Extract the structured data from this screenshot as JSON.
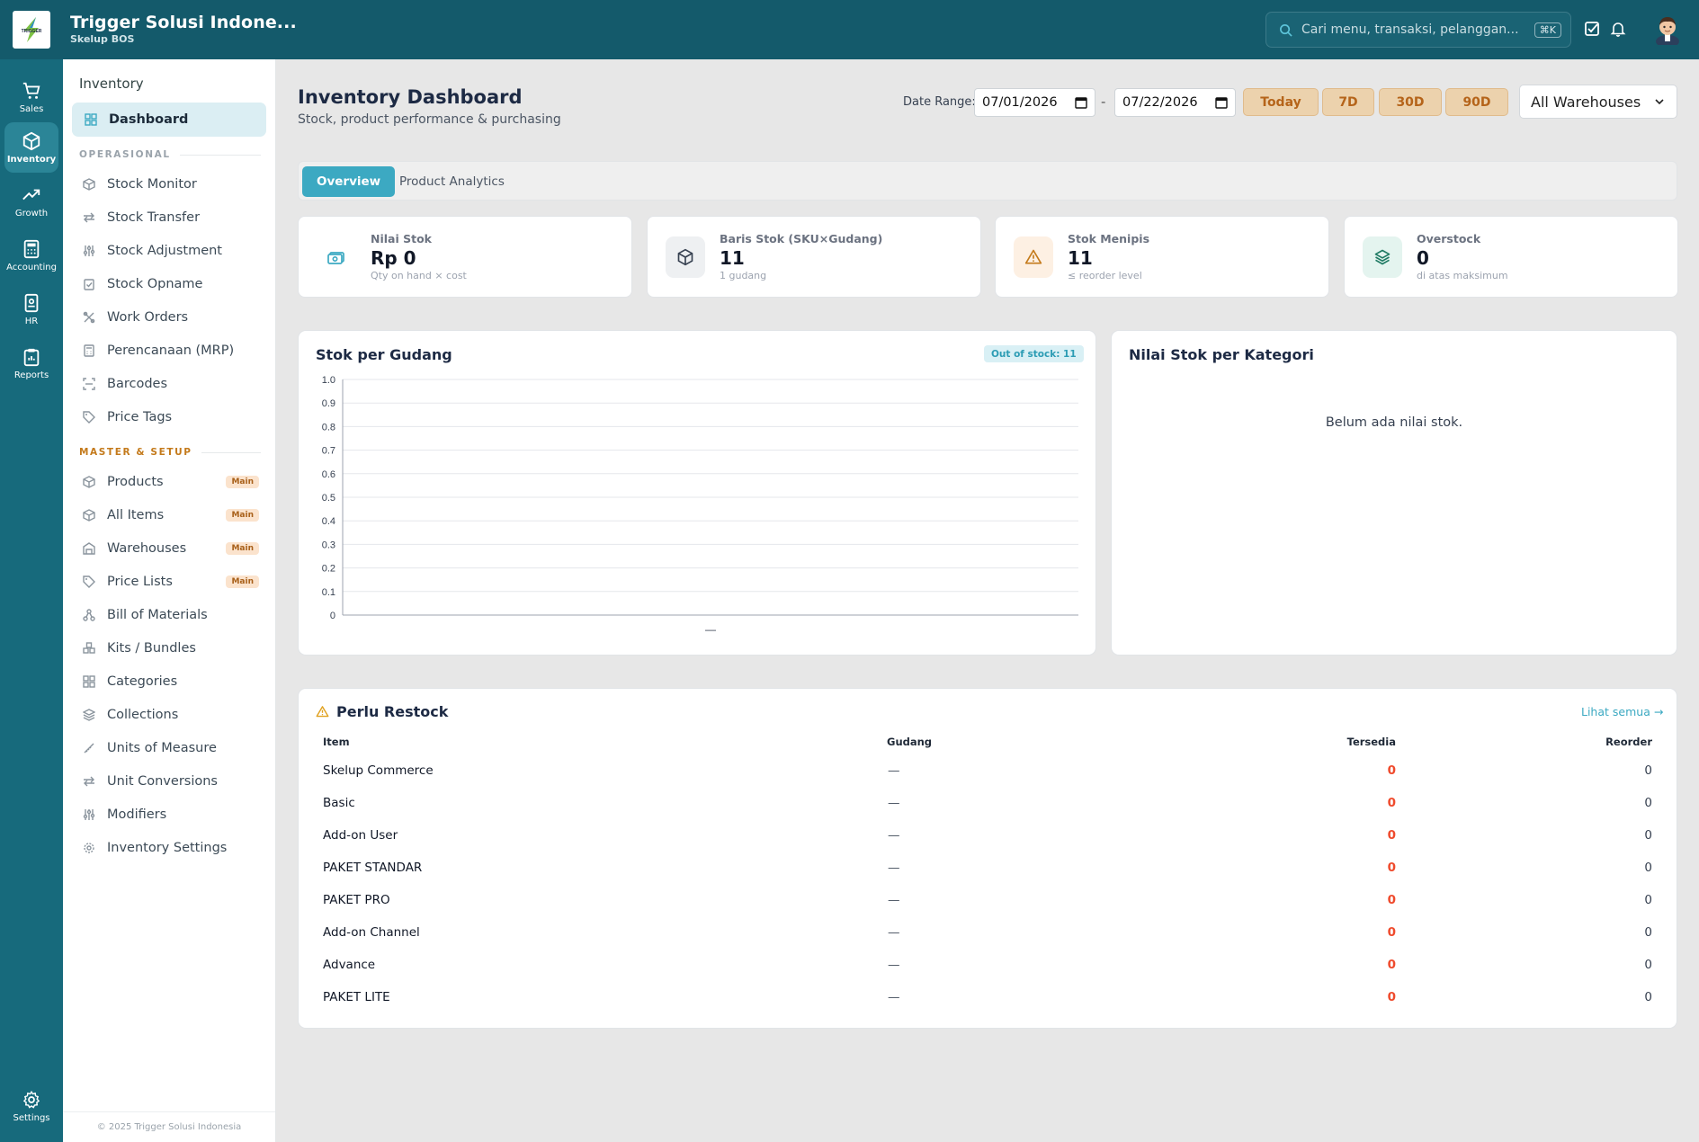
{
  "app": {
    "name": "Trigger Solusi Indone...",
    "subtitle": "Skelup BOS",
    "logo_text": "TRIGGER"
  },
  "search": {
    "placeholder": "Cari menu, transaksi, pelanggan...",
    "shortcut": "⌘K"
  },
  "rail": [
    {
      "label": "Sales",
      "icon": "cart-icon"
    },
    {
      "label": "Inventory",
      "icon": "box-icon",
      "active": true
    },
    {
      "label": "Growth",
      "icon": "trending-up-icon"
    },
    {
      "label": "Accounting",
      "icon": "calculator-icon"
    },
    {
      "label": "HR",
      "icon": "id-badge-icon"
    },
    {
      "label": "Reports",
      "icon": "clipboard-icon"
    },
    {
      "label": "Settings",
      "icon": "gear-icon"
    }
  ],
  "sidebar": {
    "title": "Inventory",
    "active_item": "Dashboard",
    "sections": [
      {
        "label": "OPERASIONAL",
        "items": [
          {
            "label": "Stock Monitor",
            "icon": "box-icon"
          },
          {
            "label": "Stock Transfer",
            "icon": "arrows-icon"
          },
          {
            "label": "Stock Adjustment",
            "icon": "sliders-icon"
          },
          {
            "label": "Stock Opname",
            "icon": "clipboard-check-icon"
          },
          {
            "label": "Work Orders",
            "icon": "tools-icon"
          },
          {
            "label": "Perencanaan (MRP)",
            "icon": "calculator-icon"
          },
          {
            "label": "Barcodes",
            "icon": "scan-icon"
          },
          {
            "label": "Price Tags",
            "icon": "tag-icon"
          }
        ]
      },
      {
        "label": "MASTER & SETUP",
        "items": [
          {
            "label": "Products",
            "icon": "box-icon",
            "badge": "Main"
          },
          {
            "label": "All Items",
            "icon": "box-icon",
            "badge": "Main"
          },
          {
            "label": "Warehouses",
            "icon": "warehouse-icon",
            "badge": "Main"
          },
          {
            "label": "Price Lists",
            "icon": "tag-icon",
            "badge": "Main"
          },
          {
            "label": "Bill of Materials",
            "icon": "network-icon"
          },
          {
            "label": "Kits / Bundles",
            "icon": "boxes-icon"
          },
          {
            "label": "Categories",
            "icon": "grid-icon"
          },
          {
            "label": "Collections",
            "icon": "layers-icon"
          },
          {
            "label": "Units of Measure",
            "icon": "ruler-icon"
          },
          {
            "label": "Unit Conversions",
            "icon": "arrows-icon"
          },
          {
            "label": "Modifiers",
            "icon": "sliders-icon"
          },
          {
            "label": "Inventory Settings",
            "icon": "gear-icon"
          }
        ]
      }
    ],
    "footer": "© 2025 Trigger Solusi Indonesia"
  },
  "header": {
    "title": "Inventory Dashboard",
    "subtitle": "Stock, product performance & purchasing",
    "date_range_label": "Date Range:",
    "date_from": "07/01/2026",
    "date_to": "07/22/2026",
    "date_sep": "-",
    "quick_ranges": [
      "Today",
      "7D",
      "30D",
      "90D"
    ],
    "warehouse": "All Warehouses"
  },
  "tabs": [
    {
      "label": "Overview",
      "active": true
    },
    {
      "label": "Product Analytics",
      "active": false
    }
  ],
  "kpis": [
    {
      "label": "Nilai Stok",
      "value": "Rp 0",
      "sub": "Qty on hand × cost",
      "icon": "money-icon",
      "tint": "#ffffff",
      "color": "#3ca9c2"
    },
    {
      "label": "Baris Stok (SKU×Gudang)",
      "value": "11",
      "sub": "1 gudang",
      "icon": "box-icon",
      "tint": "#eef0f2",
      "color": "#374151"
    },
    {
      "label": "Stok Menipis",
      "value": "11",
      "sub": "≤ reorder level",
      "icon": "warning-icon",
      "tint": "#fdf0e3",
      "color": "#c47a1b"
    },
    {
      "label": "Overstock",
      "value": "0",
      "sub": "di atas maksimum",
      "icon": "layers-icon",
      "tint": "#e4f4ef",
      "color": "#1f7a63"
    }
  ],
  "stock_chart": {
    "title": "Stok per Gudang",
    "badge": "Out of stock: 11"
  },
  "chart_data": {
    "type": "bar",
    "title": "Stok per Gudang",
    "categories": [
      "—"
    ],
    "values": [
      0
    ],
    "ylim": [
      0,
      1.0
    ],
    "yticks": [
      "1.0",
      "0.9",
      "0.8",
      "0.7",
      "0.6",
      "0.5",
      "0.4",
      "0.3",
      "0.2",
      "0.1",
      "0"
    ],
    "grid": true
  },
  "category_card": {
    "title": "Nilai Stok per Kategori",
    "empty": "Belum ada nilai stok."
  },
  "restock": {
    "title": "Perlu Restock",
    "link": "Lihat semua →",
    "columns": [
      "Item",
      "Gudang",
      "Tersedia",
      "Reorder"
    ],
    "rows": [
      {
        "item": "Skelup Commerce",
        "gudang": "—",
        "tersedia": "0",
        "reorder": "0"
      },
      {
        "item": "Basic",
        "gudang": "—",
        "tersedia": "0",
        "reorder": "0"
      },
      {
        "item": "Add-on User",
        "gudang": "—",
        "tersedia": "0",
        "reorder": "0"
      },
      {
        "item": "PAKET STANDAR",
        "gudang": "—",
        "tersedia": "0",
        "reorder": "0"
      },
      {
        "item": "PAKET PRO",
        "gudang": "—",
        "tersedia": "0",
        "reorder": "0"
      },
      {
        "item": "Add-on Channel",
        "gudang": "—",
        "tersedia": "0",
        "reorder": "0"
      },
      {
        "item": "Advance",
        "gudang": "—",
        "tersedia": "0",
        "reorder": "0"
      },
      {
        "item": "PAKET LITE",
        "gudang": "—",
        "tersedia": "0",
        "reorder": "0"
      }
    ]
  },
  "colors": {
    "topbar": "#145a6b",
    "rail": "#176a7c",
    "accent": "#3ca9c2",
    "danger": "#ef4a2c",
    "warning": "#c47a1b"
  }
}
